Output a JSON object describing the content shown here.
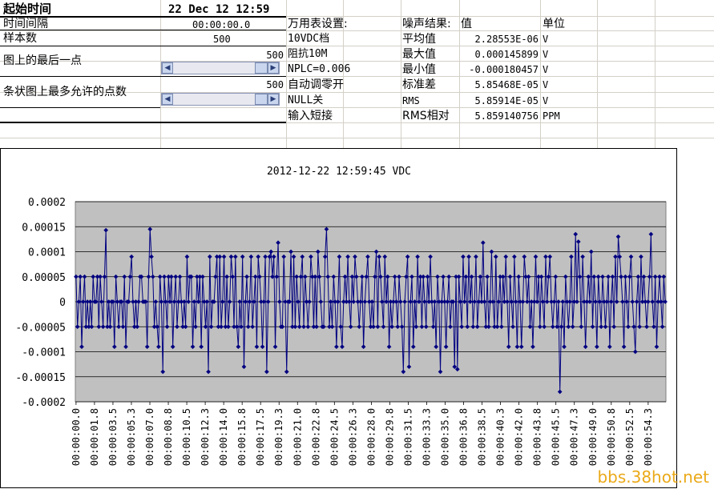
{
  "sheet": {
    "start_time_label": "起始时间",
    "start_time_value": "22 Dec 12 12:59",
    "interval_label": "时间间隔",
    "interval_value": "00:00:00.0",
    "samples_label": "样本数",
    "samples_value": "500",
    "last_point_label": "图上的最后一点",
    "last_point_value": "500",
    "max_points_label": "条状图上最多允许的点数",
    "max_points_value": "500",
    "settings": {
      "header": "万用表设置:",
      "items": [
        "10VDC档",
        "阻抗10M",
        "NPLC=0.006",
        "自动调零开",
        "NULL关",
        "输入短接"
      ]
    },
    "results": {
      "header_name": "噪声结果:",
      "header_value": "值",
      "header_unit": "单位",
      "rows": [
        {
          "name": "平均值",
          "value": "2.28553E-06",
          "unit": "V"
        },
        {
          "name": "最大值",
          "value": "0.000145899",
          "unit": "V"
        },
        {
          "name": "最小值",
          "value": "-0.000180457",
          "unit": "V"
        },
        {
          "name": "标准差",
          "value": "5.85468E-05",
          "unit": "V"
        },
        {
          "name": "RMS",
          "value": "5.85914E-05",
          "unit": "V"
        },
        {
          "name": "RMS相对",
          "value": "5.859140756",
          "unit": "PPM"
        }
      ]
    }
  },
  "watermark": "bbs.38hot.net",
  "chart_data": {
    "type": "line",
    "title": "2012-12-22 12:59:45 VDC",
    "ylim": [
      -0.0002,
      0.0002
    ],
    "yticks": [
      "0.0002",
      "0.00015",
      "0.0001",
      "0.00005",
      "0",
      "-0.00005",
      "-0.0001",
      "-0.00015",
      "-0.0002"
    ],
    "xticks": [
      "00:00:00.0",
      "00:00:01.8",
      "00:00:03.5",
      "00:00:05.3",
      "00:00:07.0",
      "00:00:08.8",
      "00:00:10.5",
      "00:00:12.3",
      "00:00:14.0",
      "00:00:15.8",
      "00:00:17.5",
      "00:00:19.3",
      "00:00:21.0",
      "00:00:22.8",
      "00:00:24.5",
      "00:00:26.3",
      "00:00:28.0",
      "00:00:29.8",
      "00:00:31.5",
      "00:00:33.3",
      "00:00:35.0",
      "00:00:36.8",
      "00:00:38.5",
      "00:00:40.3",
      "00:00:42.0",
      "00:00:43.8",
      "00:00:45.5",
      "00:00:47.3",
      "00:00:49.0",
      "00:00:50.8",
      "00:00:52.5",
      "00:00:54.3"
    ],
    "grid": true,
    "plot_bg": "#c0c0c0",
    "line_color": "#000080",
    "series": [
      {
        "values": [
          5e-05,
          -5e-05,
          0.0,
          5e-05,
          -9e-05,
          0.0,
          5e-05,
          -5e-05,
          0.0,
          -5e-05,
          0.0,
          -5e-05,
          5e-05,
          0.0,
          0.0,
          5e-05,
          -5e-05,
          5e-05,
          0.0,
          -5e-05,
          5e-05,
          0.000143,
          -5e-05,
          0.0,
          -5e-05,
          0.0,
          0.0,
          -9e-05,
          5e-05,
          0.0,
          -5e-05,
          0.0,
          0.0,
          -5e-05,
          5e-05,
          -9e-05,
          0.0,
          0.0,
          5e-05,
          9e-05,
          0.0,
          -5e-05,
          0.0,
          -5e-05,
          0.0,
          5e-05,
          5e-05,
          0.0,
          0.0,
          0.0,
          -9e-05,
          5e-05,
          0.000145,
          9e-05,
          5e-05,
          -5e-05,
          0.0,
          -5e-05,
          -9e-05,
          5e-05,
          0.0,
          -0.00014,
          5e-05,
          0.0,
          -5e-05,
          5e-05,
          0.0,
          5e-05,
          -9e-05,
          0.0,
          5e-05,
          -5e-05,
          0.0,
          5e-05,
          0.0,
          -5e-05,
          0.0,
          -5e-05,
          9e-05,
          0.0,
          5e-05,
          5e-05,
          -9e-05,
          0.0,
          -5e-05,
          5e-05,
          0.0,
          5e-05,
          -9e-05,
          5e-05,
          0.0,
          -5e-05,
          0.0,
          -0.00014,
          9e-05,
          -5e-05,
          0.0,
          0.0,
          5e-05,
          9e-05,
          -5e-05,
          9e-05,
          -5e-05,
          0.0,
          9e-05,
          -5e-05,
          5e-05,
          -5e-05,
          0.0,
          9e-05,
          5e-05,
          -5e-05,
          9e-05,
          -5e-05,
          -9e-05,
          0.0,
          -5e-05,
          9e-05,
          -0.00013,
          0.0,
          5e-05,
          -5e-05,
          0.0,
          9e-05,
          -5e-05,
          0.0,
          5e-05,
          -9e-05,
          9e-05,
          5e-05,
          0.0,
          -9e-05,
          0.0,
          9e-05,
          -0.00014,
          0.0,
          9e-05,
          0.0001,
          5e-05,
          9e-05,
          -9e-05,
          5e-05,
          0.000118,
          0.0,
          -5e-05,
          -5e-05,
          9e-05,
          0.0,
          -0.00014,
          0.0,
          0.0,
          0.0001,
          -5e-05,
          9e-05,
          -5e-05,
          5e-05,
          0.0,
          -5e-05,
          5e-05,
          9e-05,
          -5e-05,
          5e-05,
          0.0,
          -5e-05,
          0.0,
          9e-05,
          5e-05,
          -5e-05,
          5e-05,
          -5e-05,
          0.0001,
          5e-05,
          0.0,
          -5e-05,
          -5e-05,
          9e-05,
          0.000145,
          5e-05,
          -5e-05,
          0.0,
          -5e-05,
          5e-05,
          0.0,
          -9e-05,
          0.0,
          9e-05,
          -5e-05,
          -9e-05,
          0.0,
          5e-05,
          0.0,
          9e-05,
          0.0,
          -5e-05,
          5e-05,
          0.0,
          9e-05,
          5e-05,
          0.0,
          -5e-05,
          0.0,
          5e-05,
          -9e-05,
          0.0,
          5e-05,
          9e-05,
          0.0,
          -5e-05,
          0.0,
          -5e-05,
          5e-05,
          0.0001,
          -5e-05,
          9e-05,
          5e-05,
          0.0,
          -5e-05,
          9e-05,
          0.0,
          5e-05,
          -9e-05,
          0.0,
          -5e-05,
          0.0,
          5e-05,
          0.0,
          -5e-05,
          5e-05,
          0.0,
          -5e-05,
          -0.00014,
          0.0,
          5e-05,
          9e-05,
          -0.00013,
          0.0,
          5e-05,
          -9e-05,
          0.0,
          -5e-05,
          9e-05,
          0.0,
          5e-05,
          -5e-05,
          5e-05,
          0.0,
          -5e-05,
          5e-05,
          0.0,
          9e-05,
          0.0,
          -5e-05,
          0.0,
          -9e-05,
          5e-05,
          0.0,
          -0.00014,
          0.0,
          5e-05,
          0.0,
          -9e-05,
          0.0,
          5e-05,
          -5e-05,
          0.0,
          0.0,
          -0.00013,
          5e-05,
          -0.000135,
          5e-05,
          0.0,
          -5e-05,
          9e-05,
          0.0,
          5e-05,
          -5e-05,
          9e-05,
          0.0,
          5e-05,
          -5e-05,
          0.0,
          9e-05,
          -5e-05,
          0.0,
          5e-05,
          0.0,
          0.000118,
          0.0,
          -5e-05,
          5e-05,
          -5e-05,
          0.0,
          0.0001,
          0.0,
          -5e-05,
          9e-05,
          -5e-05,
          0.0,
          5e-05,
          -5e-05,
          5e-05,
          0.0,
          9e-05,
          0.0,
          -9e-05,
          5e-05,
          0.0,
          -5e-05,
          9e-05,
          0.0,
          -9e-05,
          5e-05,
          0.0,
          -9e-05,
          0.0,
          9e-05,
          5e-05,
          0.0,
          5e-05,
          -5e-05,
          0.0,
          -9e-05,
          0.0,
          9e-05,
          0.0,
          5e-05,
          -5e-05,
          5e-05,
          0.0,
          -5e-05,
          9e-05,
          0.0,
          5e-05,
          9e-05,
          0.0,
          -5e-05,
          0.0,
          5e-05,
          -5e-05,
          0.0,
          -0.00018,
          -5e-05,
          0.0,
          -9e-05,
          5e-05,
          0.0,
          -5e-05,
          0.0,
          9e-05,
          -5e-05,
          0.0,
          0.000135,
          0.0,
          0.00012,
          5e-05,
          -5e-05,
          9e-05,
          0.0,
          -9e-05,
          0.0,
          5e-05,
          0.0,
          0.0001,
          -5e-05,
          5e-05,
          0.0,
          -9e-05,
          5e-05,
          0.0,
          -5e-05,
          5e-05,
          0.0,
          -5e-05,
          0.0,
          5e-05,
          -9e-05,
          0.0,
          5e-05,
          -5e-05,
          9e-05,
          0.0,
          0.00013,
          9e-05,
          5e-05,
          0.0,
          -9e-05,
          5e-05,
          0.0,
          -5e-05,
          5e-05,
          9e-05,
          0.0,
          -5e-05,
          -0.0001,
          0.0,
          5e-05,
          -5e-05,
          9e-05,
          0.0,
          5e-05,
          0.0,
          -5e-05,
          0.0,
          5e-05,
          0.000135,
          0.0,
          -5e-05,
          5e-05,
          -9e-05,
          0.0,
          5e-05,
          0.0,
          -5e-05,
          5e-05,
          0.0
        ]
      }
    ]
  }
}
